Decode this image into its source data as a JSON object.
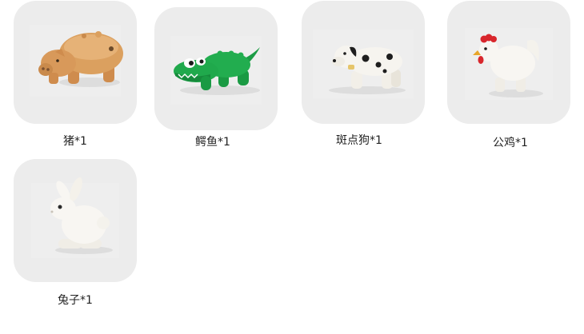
{
  "items": [
    {
      "label": "猪*1",
      "icon": "pig-toy-icon",
      "color": "#d89a5a"
    },
    {
      "label": "鳄鱼*1",
      "icon": "crocodile-toy-icon",
      "color": "#1fa84a"
    },
    {
      "label": "斑点狗*1",
      "icon": "dalmatian-toy-icon",
      "color": "#f4f2ee"
    },
    {
      "label": "公鸡*1",
      "icon": "rooster-toy-icon",
      "color": "#f6f4f0"
    },
    {
      "label": "兔子*1",
      "icon": "rabbit-toy-icon",
      "color": "#f6f4f0"
    }
  ]
}
